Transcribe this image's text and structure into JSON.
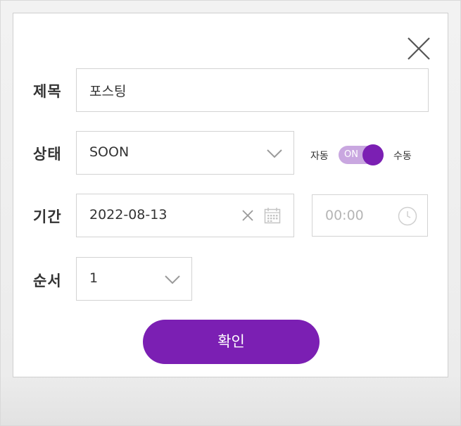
{
  "form": {
    "title_label": "제목",
    "title_value": "포스팅",
    "status_label": "상태",
    "status_value": "SOON",
    "toggle_left": "자동",
    "toggle_state": "ON",
    "toggle_right": "수동",
    "period_label": "기간",
    "date_value": "2022-08-13",
    "time_placeholder": "00:00",
    "order_label": "순서",
    "order_value": "1",
    "confirm_label": "확인"
  },
  "colors": {
    "accent": "#7b1fb3",
    "toggle_track": "#c9a7e0",
    "border": "#d3d3d3"
  },
  "icons": [
    "close-icon",
    "chevron-down-icon",
    "clear-icon",
    "calendar-icon",
    "clock-icon"
  ]
}
